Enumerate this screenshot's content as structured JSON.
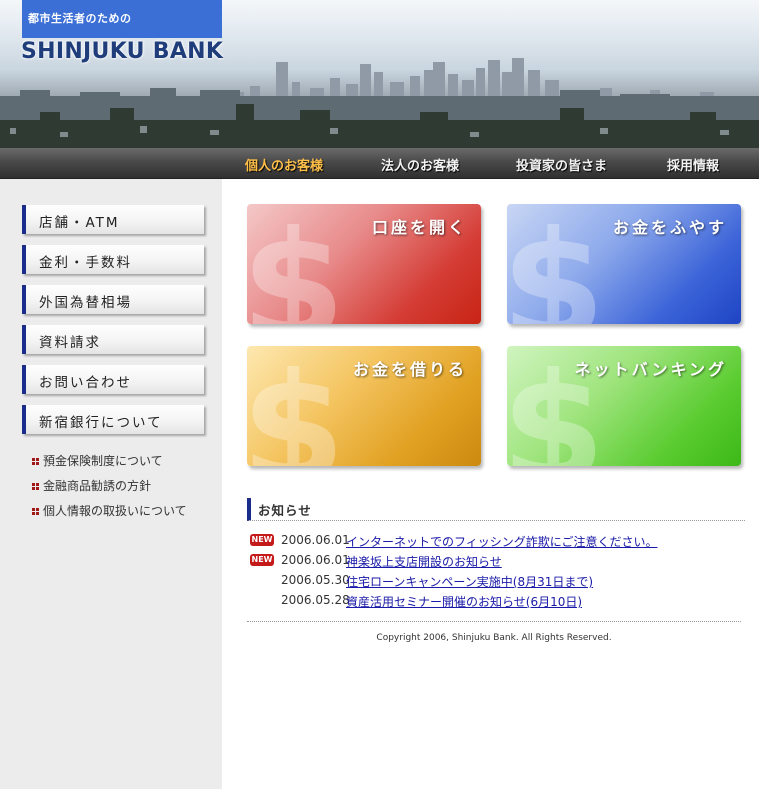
{
  "header": {
    "tagline": "都市生活者のための",
    "logo": "SHINJUKU BANK"
  },
  "nav": [
    {
      "label": "個人のお客様",
      "active": true
    },
    {
      "label": "法人のお客様",
      "active": false
    },
    {
      "label": "投資家の皆さま",
      "active": false
    },
    {
      "label": "採用情報",
      "active": false
    }
  ],
  "sidebar": {
    "menu": [
      "店舗・ATM",
      "金利・手数料",
      "外国為替相場",
      "資料請求",
      "お問い合わせ",
      "新宿銀行について"
    ],
    "links": [
      "預金保険制度について",
      "金融商品勧誘の方針",
      "個人情報の取扱いについて"
    ]
  },
  "tiles": [
    {
      "label": "口座を開く",
      "icon": "dollar-sign",
      "color": "#d43c34"
    },
    {
      "label": "お金をふやす",
      "icon": "dollar-sign",
      "color": "#3c64d8"
    },
    {
      "label": "お金を借りる",
      "icon": "dollar-sign",
      "color": "#e0a020"
    },
    {
      "label": "ネットバンキング",
      "icon": "dollar-sign",
      "color": "#5acc30"
    }
  ],
  "news": {
    "heading": "お知らせ",
    "badge": "NEW",
    "items": [
      {
        "date": "2006.06.01",
        "text": "インターネットでのフィッシング詐欺にご注意ください。",
        "is_new": true
      },
      {
        "date": "2006.06.01",
        "text": "神楽坂上支店開設のお知らせ",
        "is_new": true
      },
      {
        "date": "2006.05.30",
        "text": "住宅ローンキャンペーン実施中(8月31日まで)",
        "is_new": false
      },
      {
        "date": "2006.05.28",
        "text": "資産活用セミナー開催のお知らせ(6月10日)",
        "is_new": false
      }
    ]
  },
  "footer": {
    "copyright": "Copyright 2006, Shinjuku Bank. All Rights Reserved."
  }
}
